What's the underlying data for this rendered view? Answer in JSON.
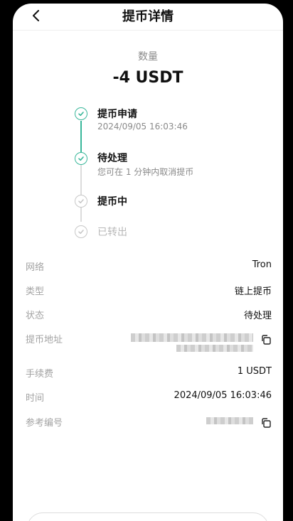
{
  "header": {
    "title": "提币详情"
  },
  "summary": {
    "quantity_label": "数量",
    "amount": "-4 USDT"
  },
  "timeline": [
    {
      "title": "提币申请",
      "subtitle": "2024/09/05 16:03:46",
      "state": "done"
    },
    {
      "title": "待处理",
      "subtitle": "您可在 1 分钟内取消提币",
      "state": "done"
    },
    {
      "title": "提币中",
      "subtitle": "",
      "state": "pending"
    },
    {
      "title": "已转出",
      "subtitle": "",
      "state": "pending"
    }
  ],
  "details": {
    "network": {
      "label": "网络",
      "value": "Tron"
    },
    "type": {
      "label": "类型",
      "value": "链上提币"
    },
    "status": {
      "label": "状态",
      "value": "待处理"
    },
    "address": {
      "label": "提币地址"
    },
    "fee": {
      "label": "手续费",
      "value": "1 USDT"
    },
    "time": {
      "label": "时间",
      "value": "2024/09/05 16:03:46"
    },
    "reference": {
      "label": "参考编号"
    }
  },
  "colors": {
    "accent": "#39b79a",
    "inactive": "#c8c8c8"
  }
}
